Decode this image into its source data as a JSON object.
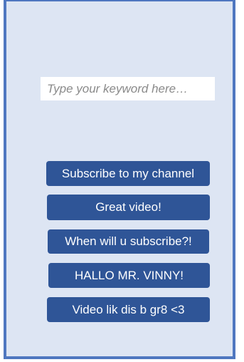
{
  "search": {
    "placeholder": "Type your keyword here…",
    "value": ""
  },
  "comments": [
    {
      "label": "Subscribe to my channel"
    },
    {
      "label": "Great video!"
    },
    {
      "label": "When will u subscribe?!"
    },
    {
      "label": "HALLO MR. VINNY!"
    },
    {
      "label": "Video lik dis b gr8 <3"
    }
  ],
  "colors": {
    "panel_background": "#dde5f3",
    "panel_border": "#4f77c0",
    "button_background": "#2f5597",
    "button_text": "#ffffff",
    "placeholder_text": "#8a8a8a"
  }
}
